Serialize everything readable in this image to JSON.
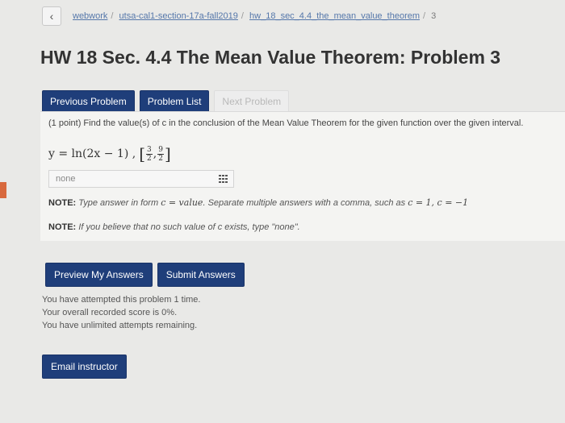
{
  "breadcrumb": {
    "back_icon": "chevron-left-icon",
    "items": [
      "webwork",
      "utsa-cal1-section-17a-fall2019",
      "hw_18_sec_4.4_the_mean_value_theorem",
      "3"
    ]
  },
  "page_title": "HW 18 Sec. 4.4 The Mean Value Theorem: Problem 3",
  "nav": {
    "previous": "Previous Problem",
    "list": "Problem List",
    "next": "Next Problem"
  },
  "problem": {
    "prompt": "(1 point) Find the value(s) of c in the conclusion of the Mean Value Theorem for the given function over the given interval.",
    "function": "y = ln(2x − 1) ,",
    "interval_lower_num": "3",
    "interval_lower_den": "2",
    "interval_upper_num": "9",
    "interval_upper_den": "2",
    "answer_value": "none",
    "note1_label": "NOTE:",
    "note1_text": "Type answer in form",
    "note1_form": "c = value",
    "note1_text2": ". Separate multiple answers with a comma, such as",
    "note1_example": "c = 1, c = −1",
    "note2_label": "NOTE:",
    "note2_text": "If you believe that no such value of c exists, type \"none\"."
  },
  "actions": {
    "preview": "Preview My Answers",
    "submit": "Submit Answers"
  },
  "attempts": [
    "You have attempted this problem 1 time.",
    "Your overall recorded score is 0%.",
    "You have unlimited attempts remaining."
  ],
  "email": "Email instructor",
  "colors": {
    "button": "#1f3e7a",
    "background": "#e9e9e7"
  }
}
